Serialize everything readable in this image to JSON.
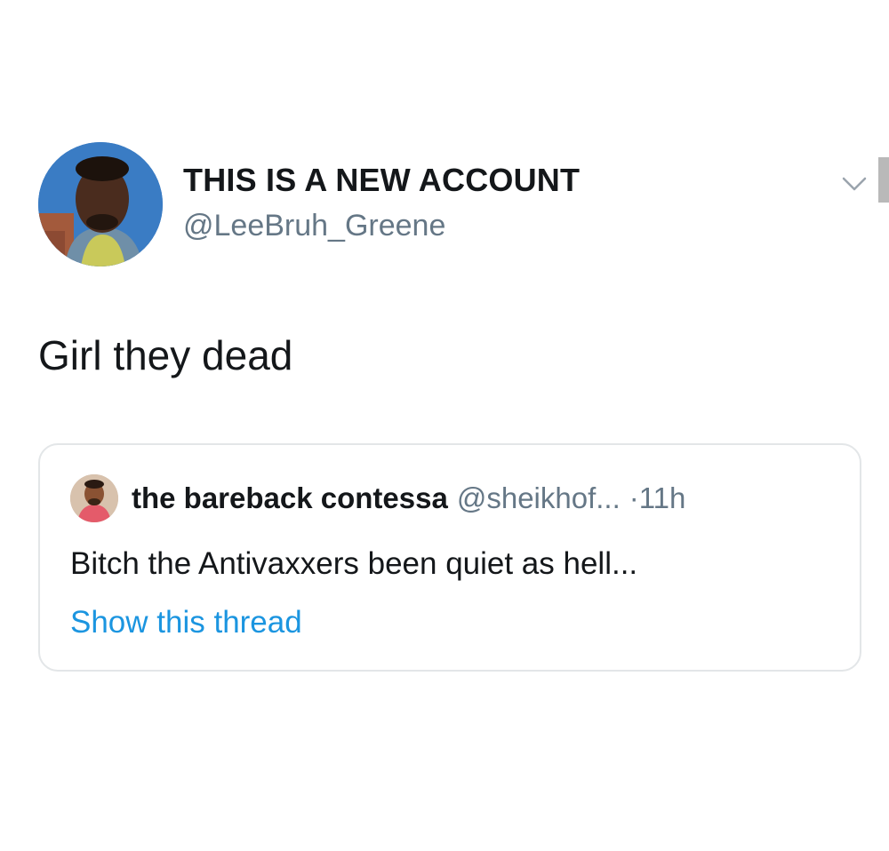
{
  "tweet": {
    "author": {
      "display_name": "THIS IS A NEW ACCOUNT",
      "handle": "@LeeBruh_Greene",
      "avatar_icon": "profile-photo"
    },
    "menu_icon": "chevron-down-icon",
    "text": "Girl they dead",
    "quote": {
      "author_name": "the bareback contessa",
      "author_handle": "@sheikhof...",
      "separator": "·",
      "time": "11h",
      "text": "Bitch the Antivaxxers been quiet as hell...",
      "show_thread_label": "Show this thread"
    }
  },
  "colors": {
    "text_primary": "#14171a",
    "text_secondary": "#657786",
    "link": "#1b95e0",
    "card_border": "#e3e6e8"
  }
}
